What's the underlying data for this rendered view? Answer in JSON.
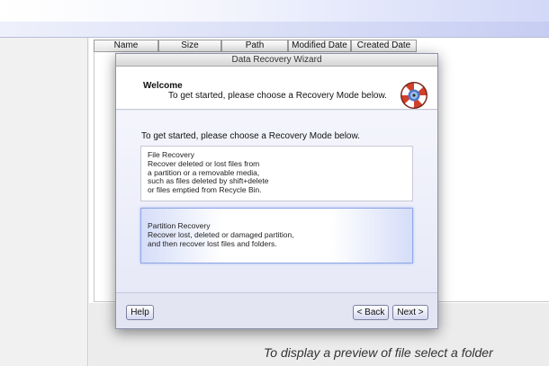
{
  "file_list": {
    "columns": [
      "Name",
      "Size",
      "Path",
      "Modified Date",
      "Created Date"
    ]
  },
  "preview_hint": "To display a preview of file select a folder",
  "wizard": {
    "title": "Data Recovery Wizard",
    "header_title": "Welcome",
    "header_subtitle": "To get started, please choose a Recovery Mode below.",
    "header_icon": "lifebuoy-icon",
    "prompt": "To get started, please choose a Recovery Mode below.",
    "modes": [
      {
        "lines": [
          "File Recovery",
          "Recover deleted or lost files from",
          "a partition or a removable media,",
          "such as files deleted by shift+delete",
          "or files emptied from Recycle Bin."
        ],
        "selected": false
      },
      {
        "lines": [
          "Partition Recovery",
          "Recover lost, deleted or damaged partition,",
          "and then recover lost files and folders."
        ],
        "selected": true
      }
    ],
    "buttons": {
      "help": "Help",
      "back": "< Back",
      "next": "Next >"
    }
  },
  "colors": {
    "selection_border": "#8ea7e6",
    "lifebuoy_red": "#d2402a",
    "lifebuoy_white": "#ffffff"
  }
}
